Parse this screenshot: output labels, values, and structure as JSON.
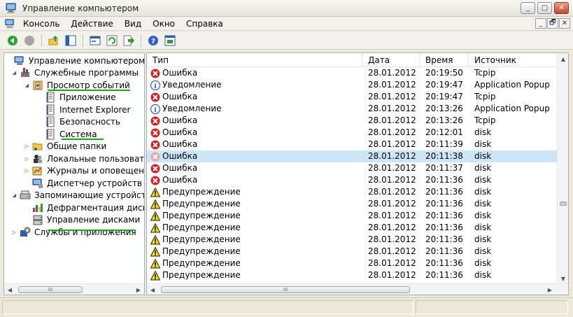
{
  "window": {
    "title": "Управление компьютером",
    "buttons": {
      "minimize": "_",
      "maximize": "□",
      "close": "✕"
    }
  },
  "menu": {
    "items": [
      "Консоль",
      "Действие",
      "Вид",
      "Окно",
      "Справка"
    ],
    "mdi_buttons": {
      "minimize": "_",
      "restore": "🗗",
      "close": "✕"
    }
  },
  "toolbar": {
    "buttons": [
      "back-icon",
      "forward-icon",
      "up-icon",
      "show-tree-icon",
      "properties-icon",
      "refresh-icon",
      "export-icon",
      "help-icon",
      "console-icon"
    ]
  },
  "tree": {
    "items": [
      {
        "label": "Управление компьютером (лс",
        "level": 0,
        "expander": "",
        "icon": "computer-management-icon"
      },
      {
        "label": "Служебные программы",
        "level": 1,
        "expander": "◢",
        "icon": "tools-icon"
      },
      {
        "label": "Просмотр событий",
        "level": 2,
        "expander": "◢",
        "icon": "event-viewer-icon"
      },
      {
        "label": "Приложение",
        "level": 3,
        "expander": "",
        "icon": "log-icon"
      },
      {
        "label": "Internet Explorer",
        "level": 3,
        "expander": "",
        "icon": "log-icon"
      },
      {
        "label": "Безопасность",
        "level": 3,
        "expander": "",
        "icon": "log-icon"
      },
      {
        "label": "Система",
        "level": 3,
        "expander": "",
        "icon": "log-icon",
        "selected": true
      },
      {
        "label": "Общие папки",
        "level": 2,
        "expander": "▷",
        "icon": "shared-folder-icon"
      },
      {
        "label": "Локальные пользовате",
        "level": 2,
        "expander": "▷",
        "icon": "users-icon"
      },
      {
        "label": "Журналы и оповещения",
        "level": 2,
        "expander": "▷",
        "icon": "logs-alerts-icon"
      },
      {
        "label": "Диспетчер устройств",
        "level": 2,
        "expander": "",
        "icon": "device-manager-icon"
      },
      {
        "label": "Запоминающие устройства",
        "level": 1,
        "expander": "◢",
        "icon": "storage-icon"
      },
      {
        "label": "Дефрагментация диска",
        "level": 2,
        "expander": "",
        "icon": "defrag-icon"
      },
      {
        "label": "Управление дисками",
        "level": 2,
        "expander": "",
        "icon": "disk-management-icon"
      },
      {
        "label": "Службы и приложения",
        "level": 1,
        "expander": "▷",
        "icon": "services-icon"
      }
    ],
    "scroll_thumb": "III"
  },
  "list": {
    "columns": [
      "Тип",
      "Дата",
      "Время",
      "Источник"
    ],
    "rows": [
      {
        "type": "Ошибка",
        "kind": "error",
        "date": "28.01.2012",
        "time": "20:19:50",
        "source": "Tcpip"
      },
      {
        "type": "Уведомление",
        "kind": "info",
        "date": "28.01.2012",
        "time": "20:19:47",
        "source": "Application Popup"
      },
      {
        "type": "Ошибка",
        "kind": "error",
        "date": "28.01.2012",
        "time": "20:19:47",
        "source": "Tcpip"
      },
      {
        "type": "Уведомление",
        "kind": "info",
        "date": "28.01.2012",
        "time": "20:13:26",
        "source": "Application Popup"
      },
      {
        "type": "Ошибка",
        "kind": "error",
        "date": "28.01.2012",
        "time": "20:13:26",
        "source": "Tcpip"
      },
      {
        "type": "Ошибка",
        "kind": "error",
        "date": "28.01.2012",
        "time": "20:12:01",
        "source": "disk"
      },
      {
        "type": "Ошибка",
        "kind": "error",
        "date": "28.01.2012",
        "time": "20:11:39",
        "source": "disk"
      },
      {
        "type": "Ошибка",
        "kind": "error",
        "date": "28.01.2012",
        "time": "20:11:38",
        "source": "disk",
        "selected": true
      },
      {
        "type": "Ошибка",
        "kind": "error",
        "date": "28.01.2012",
        "time": "20:11:37",
        "source": "disk"
      },
      {
        "type": "Ошибка",
        "kind": "error",
        "date": "28.01.2012",
        "time": "20:11:36",
        "source": "disk"
      },
      {
        "type": "Предупреждение",
        "kind": "warning",
        "date": "28.01.2012",
        "time": "20:11:36",
        "source": "disk"
      },
      {
        "type": "Предупреждение",
        "kind": "warning",
        "date": "28.01.2012",
        "time": "20:11:36",
        "source": "disk"
      },
      {
        "type": "Предупреждение",
        "kind": "warning",
        "date": "28.01.2012",
        "time": "20:11:36",
        "source": "disk"
      },
      {
        "type": "Предупреждение",
        "kind": "warning",
        "date": "28.01.2012",
        "time": "20:11:36",
        "source": "disk"
      },
      {
        "type": "Предупреждение",
        "kind": "warning",
        "date": "28.01.2012",
        "time": "20:11:36",
        "source": "disk"
      },
      {
        "type": "Предупреждение",
        "kind": "warning",
        "date": "28.01.2012",
        "time": "20:11:36",
        "source": "disk"
      },
      {
        "type": "Предупреждение",
        "kind": "warning",
        "date": "28.01.2012",
        "time": "20:11:36",
        "source": "disk"
      },
      {
        "type": "Предупреждение",
        "kind": "warning",
        "date": "28.01.2012",
        "time": "20:11:36",
        "source": "disk"
      }
    ],
    "scroll_thumb": "III"
  },
  "colors": {
    "selection": "#cde6f7",
    "underline": "#1ca81c",
    "error": "#d42121",
    "warning": "#f7d900",
    "info": "#2b57c8"
  }
}
